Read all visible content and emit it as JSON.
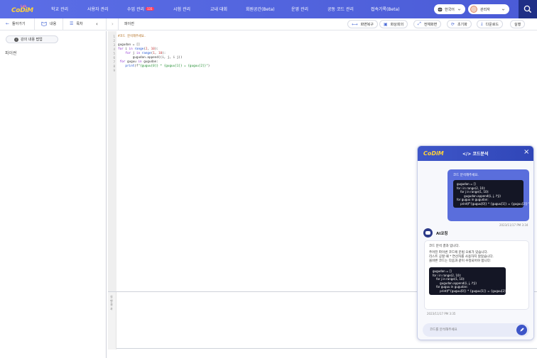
{
  "nav": {
    "logo_main": "CoDiM",
    "logo_sub": "Lab",
    "items": [
      {
        "label": "학교 관리"
      },
      {
        "label": "사용자 관리"
      },
      {
        "label": "수업 관리",
        "badge": "131"
      },
      {
        "label": "시험 관리"
      },
      {
        "label": "교내 대회"
      },
      {
        "label": "회원공간(Beta)"
      },
      {
        "label": "운영 관리"
      },
      {
        "label": "공동 코드 관리"
      },
      {
        "label": "접속기록(Beta)"
      }
    ],
    "language": "한국어",
    "user": "관리자",
    "colors": {
      "nav_bg": "#5b6ee6",
      "search_bg": "#1f2f86",
      "badge": "#ff3b5c"
    }
  },
  "toolbar": {
    "back": "돌아가기",
    "tab_content": "내용",
    "tab_toc": "목차",
    "language": "파이썬",
    "buttons": [
      "화면복구",
      "화상회의",
      "전체화면",
      "초기화",
      "다운로드",
      "실행"
    ]
  },
  "left": {
    "expand_label": "강의 내용 팝업",
    "content_text": "파이썬"
  },
  "editor": {
    "line_numbers": [
      "1",
      "2",
      "3",
      "4",
      "5",
      "6",
      "7",
      "8",
      "9"
    ]
  },
  "result": {
    "label": "실행결과"
  },
  "chat": {
    "title": "</> 코드분석",
    "user_question": "코드 분석해주세요.",
    "user_code": [
      "gugudan = []",
      "for i in range(2, 10):",
      "    for j in range(1, 10):",
      "        gugudan.append((i, j, i*j))",
      "for guguu in gugudan:",
      "    print(f\"{guguu[0]} * {guguu[1]} = {guguu[2]}\")"
    ],
    "timestamp_user": "2023/11/17 PM 3:34",
    "ai_name": "AI코칭",
    "ai_lines": [
      "코드 분석 결과 입니다.",
      "",
      "주어진 파이썬 코드에 문법 오류가 있습니다.",
      "리스트 공할 때 * 연산자를 사용하지 않았습니다.",
      "올바른 코드는 다음과 같이 수정되어야 합니다:"
    ],
    "ai_code": [
      "gugudan = []",
      "for i in range(2, 10):",
      "    for j in range(1, 10):",
      "        gugudan.append((i, j, i*j))",
      "    for guguu in gugudan:",
      "        print(f\"{guguu[0]} * {guguu[1]} = {guguu[2]}\")"
    ],
    "timestamp_ai": "2023/11/17 PM 3:35",
    "input_placeholder": "코드를 분석해주세요",
    "colors": {
      "header": "#3e56c8",
      "user_bubble": "#5a6edc",
      "code_bg": "#141625"
    }
  }
}
